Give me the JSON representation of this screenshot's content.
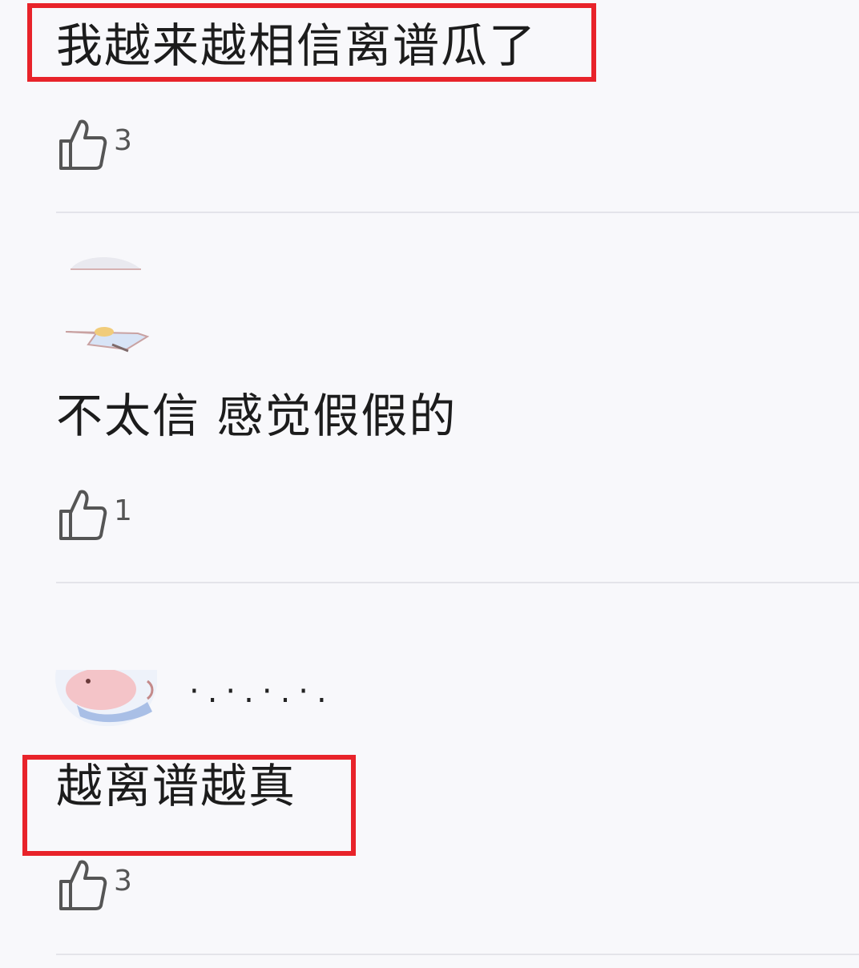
{
  "comments": [
    {
      "text": "我越来越相信离谱瓜了",
      "likes": "3",
      "highlighted": true
    },
    {
      "text": "不太信  感觉假假的",
      "likes": "1",
      "highlighted": false
    },
    {
      "text": "越离谱越真",
      "likes": "3",
      "highlighted": true,
      "username": "·.·.·.·."
    }
  ],
  "colors": {
    "highlight": "#e8232a",
    "background": "#f8f8fb",
    "divider": "#e4e4ea"
  },
  "icons": {
    "like": "thumbs-up-icon"
  }
}
